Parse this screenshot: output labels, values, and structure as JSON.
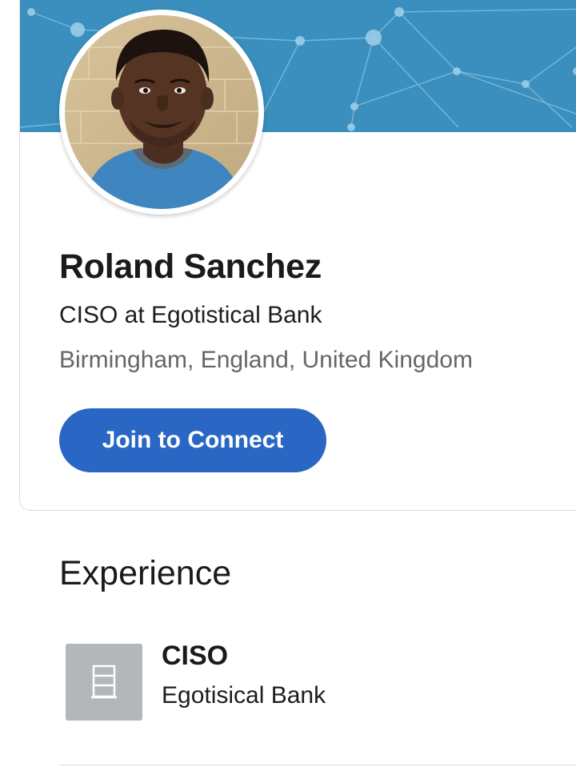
{
  "profile": {
    "name": "Roland Sanchez",
    "headline": "CISO at Egotistical Bank",
    "location": "Birmingham, England, United Kingdom",
    "connect_label": "Join to Connect"
  },
  "experience": {
    "title": "Experience",
    "items": [
      {
        "title": "CISO",
        "company": "Egotisical Bank",
        "logo_icon": "building-icon"
      }
    ]
  },
  "colors": {
    "cover": "#3a8fbe",
    "button": "#2a67c4",
    "logo_placeholder": "#b4b7ba"
  }
}
